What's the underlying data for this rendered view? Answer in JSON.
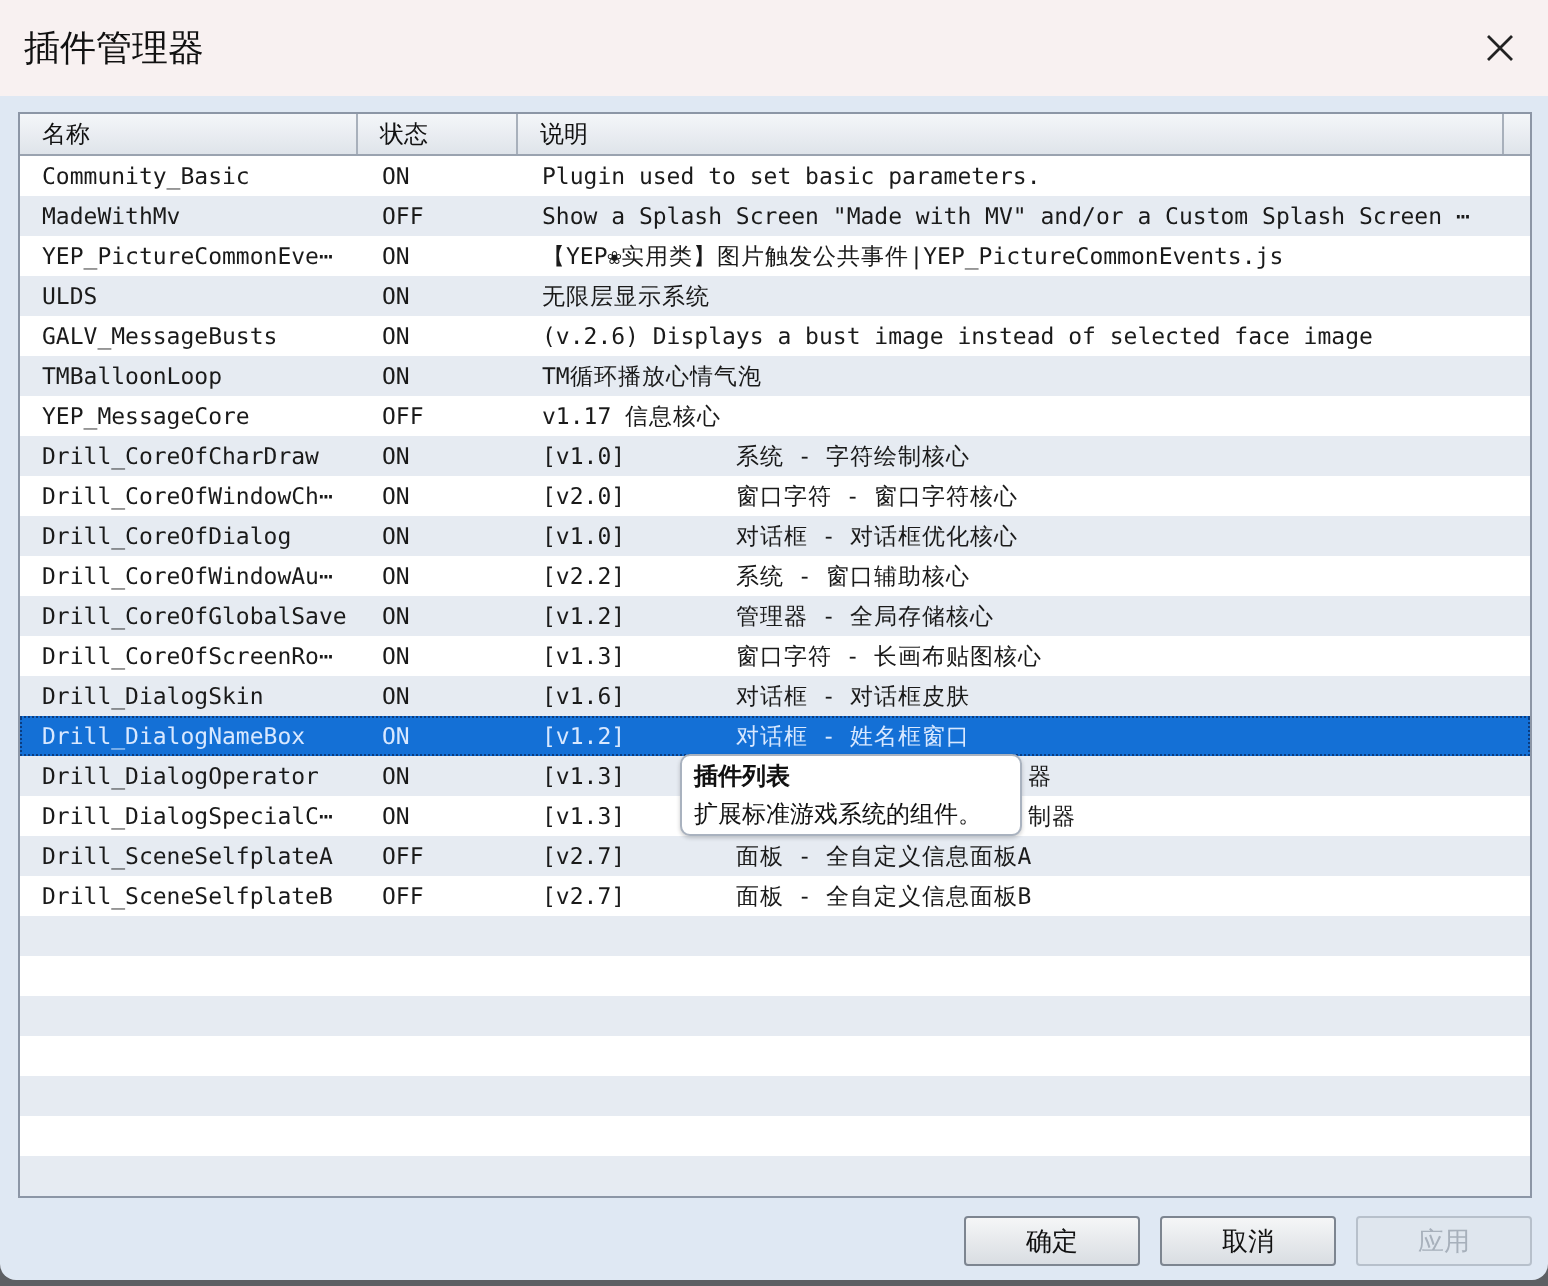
{
  "window": {
    "title": "插件管理器"
  },
  "table": {
    "columns": [
      "名称",
      "状态",
      "说明"
    ],
    "rows": [
      {
        "kind": "plain",
        "name": "Community_Basic",
        "status": "ON",
        "desc": "Plugin used to set basic parameters.",
        "selected": false
      },
      {
        "kind": "plain",
        "name": "MadeWithMv",
        "status": "OFF",
        "desc": "Show a Splash Screen \"Made with MV\" and/or a Custom Splash Screen ⋯",
        "selected": false
      },
      {
        "kind": "plain",
        "name": "YEP_PictureCommonEve⋯",
        "status": "ON",
        "desc": "【YEP❀实用类】图片触发公共事件|YEP_PictureCommonEvents.js",
        "selected": false
      },
      {
        "kind": "plain",
        "name": "ULDS",
        "status": "ON",
        "desc": "无限层显示系统",
        "selected": false
      },
      {
        "kind": "plain",
        "name": "GALV_MessageBusts",
        "status": "ON",
        "desc": "(v.2.6) Displays a bust image instead of selected face image",
        "selected": false
      },
      {
        "kind": "plain",
        "name": "TMBalloonLoop",
        "status": "ON",
        "desc": "TM循环播放心情气泡",
        "selected": false
      },
      {
        "kind": "plain",
        "name": "YEP_MessageCore",
        "status": "OFF",
        "desc": "v1.17 信息核心",
        "selected": false
      },
      {
        "kind": "versioned",
        "name": "Drill_CoreOfCharDraw",
        "status": "ON",
        "version": "[v1.0]",
        "desc": "系统 - 字符绘制核心",
        "selected": false
      },
      {
        "kind": "versioned",
        "name": "Drill_CoreOfWindowCh⋯",
        "status": "ON",
        "version": "[v2.0]",
        "desc": "窗口字符 - 窗口字符核心",
        "selected": false
      },
      {
        "kind": "versioned",
        "name": "Drill_CoreOfDialog",
        "status": "ON",
        "version": "[v1.0]",
        "desc": "对话框 - 对话框优化核心",
        "selected": false
      },
      {
        "kind": "versioned",
        "name": "Drill_CoreOfWindowAu⋯",
        "status": "ON",
        "version": "[v2.2]",
        "desc": "系统 - 窗口辅助核心",
        "selected": false
      },
      {
        "kind": "versioned",
        "name": "Drill_CoreOfGlobalSave",
        "status": "ON",
        "version": "[v1.2]",
        "desc": "管理器 - 全局存储核心",
        "selected": false
      },
      {
        "kind": "versioned",
        "name": "Drill_CoreOfScreenRo⋯",
        "status": "ON",
        "version": "[v1.3]",
        "desc": "窗口字符 - 长画布贴图核心",
        "selected": false
      },
      {
        "kind": "versioned",
        "name": "Drill_DialogSkin",
        "status": "ON",
        "version": "[v1.6]",
        "desc": "对话框 - 对话框皮肤",
        "selected": false
      },
      {
        "kind": "versioned",
        "name": "Drill_DialogNameBox",
        "status": "ON",
        "version": "[v1.2]",
        "desc": "对话框 - 姓名框窗口",
        "selected": true
      },
      {
        "kind": "covered",
        "name": "Drill_DialogOperator",
        "status": "ON",
        "version": "[v1.3]",
        "desc": "器",
        "selected": false
      },
      {
        "kind": "covered",
        "name": "Drill_DialogSpecialC⋯",
        "status": "ON",
        "version": "[v1.3]",
        "desc": "制器",
        "selected": false
      },
      {
        "kind": "versioned",
        "name": "Drill_SceneSelfplateA",
        "status": "OFF",
        "version": "[v2.7]",
        "desc": "面板 - 全自定义信息面板A",
        "selected": false
      },
      {
        "kind": "versioned",
        "name": "Drill_SceneSelfplateB",
        "status": "OFF",
        "version": "[v2.7]",
        "desc": "面板 - 全自定义信息面板B",
        "selected": false
      }
    ]
  },
  "tooltip": {
    "title": "插件列表",
    "text": "扩展标准游戏系统的组件。"
  },
  "buttons": [
    {
      "label": "确定",
      "disabled": false
    },
    {
      "label": "取消",
      "disabled": false
    },
    {
      "label": "应用",
      "disabled": true
    }
  ]
}
